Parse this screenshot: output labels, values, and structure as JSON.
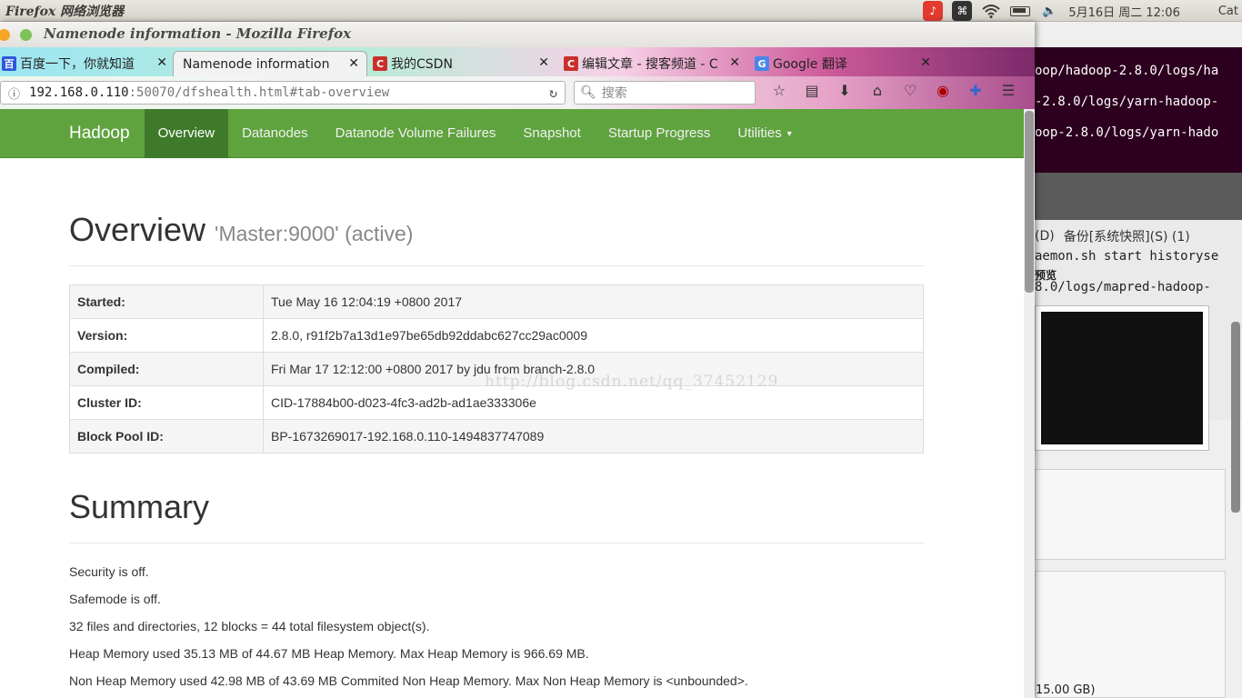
{
  "topbar": {
    "app_name": "Firefox 网络浏览器",
    "datetime": "5月16日 周二 12:06",
    "user": "Cat"
  },
  "background": {
    "terminal_lines": [
      "oop/hadoop-2.8.0/logs/ha",
      "-2.8.0/logs/yarn-hadoop-",
      "oop-2.8.0/logs/yarn-hado"
    ],
    "dialog_tab_a": "(D)",
    "dialog_tab_b": "备份[系统快照](S) (1)",
    "dialog_lines": [
      "aemon.sh start historyse",
      "预览",
      "8.0/logs/mapred-hadoop-"
    ],
    "disk_size": "15.00 GB)"
  },
  "window": {
    "title": "Namenode information - Mozilla Firefox"
  },
  "tabs": [
    {
      "label": "百度一下，你就知道",
      "favicon": "baidu-icon",
      "active": false
    },
    {
      "label": "Namenode information",
      "favicon": "",
      "active": true
    },
    {
      "label": "我的CSDN",
      "favicon": "csdn-icon",
      "active": false
    },
    {
      "label": "编辑文章 - 搜客频道 - C",
      "favicon": "csdn-icon",
      "active": false
    },
    {
      "label": "Google 翻译",
      "favicon": "google-translate-icon",
      "active": false
    }
  ],
  "urlbar": {
    "host": "192.168.0.110",
    "rest": ":50070/dfshealth.html#tab-overview"
  },
  "searchbar": {
    "placeholder": "搜索"
  },
  "hadoop_nav": {
    "brand": "Hadoop",
    "items": [
      "Overview",
      "Datanodes",
      "Datanode Volume Failures",
      "Snapshot",
      "Startup Progress",
      "Utilities"
    ]
  },
  "overview": {
    "heading": "Overview",
    "subtitle": "'Master:9000' (active)",
    "rows": [
      {
        "key": "Started:",
        "value": "Tue May 16 12:04:19 +0800 2017"
      },
      {
        "key": "Version:",
        "value": "2.8.0, r91f2b7a13d1e97be65db92ddabc627cc29ac0009"
      },
      {
        "key": "Compiled:",
        "value": "Fri Mar 17 12:12:00 +0800 2017 by jdu from branch-2.8.0"
      },
      {
        "key": "Cluster ID:",
        "value": "CID-17884b00-d023-4fc3-ad2b-ad1ae333306e"
      },
      {
        "key": "Block Pool ID:",
        "value": "BP-1673269017-192.168.0.110-1494837747089"
      }
    ]
  },
  "summary": {
    "heading": "Summary",
    "lines": [
      "Security is off.",
      "Safemode is off.",
      "32 files and directories, 12 blocks = 44 total filesystem object(s).",
      "Heap Memory used 35.13 MB of 44.67 MB Heap Memory. Max Heap Memory is 966.69 MB.",
      "Non Heap Memory used 42.98 MB of 43.69 MB Commited Non Heap Memory. Max Non Heap Memory is <unbounded>."
    ]
  },
  "watermark": "http://blog.csdn.net/qq_37452129"
}
